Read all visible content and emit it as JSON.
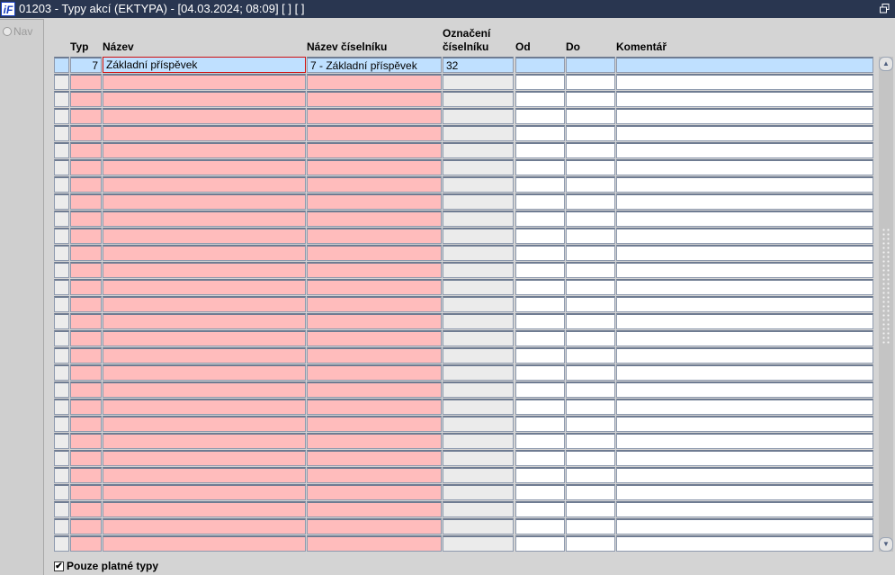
{
  "window": {
    "title": "01203 - Typy akcí (EKTYPA) - [04.03.2024; 08:09]  [ ]  [ ]",
    "logo": "iF"
  },
  "nav": {
    "label": "Nav"
  },
  "columns": {
    "typ": "Typ",
    "nazev": "Název",
    "nazev_ciselniku": "Název číselníku",
    "oznaceni_1": "Označení",
    "oznaceni_2": "číselníku",
    "od": "Od",
    "do": "Do",
    "komentar": "Komentář"
  },
  "rows": [
    {
      "typ": "7",
      "nazev": "Základní příspěvek",
      "nazev_ciselniku": "7 - Základní příspěvek",
      "oznaceni": "32",
      "od": "",
      "do": "",
      "komentar": ""
    }
  ],
  "empty_row_count": 28,
  "filter": {
    "label": "Pouze platné typy",
    "checked": true
  }
}
